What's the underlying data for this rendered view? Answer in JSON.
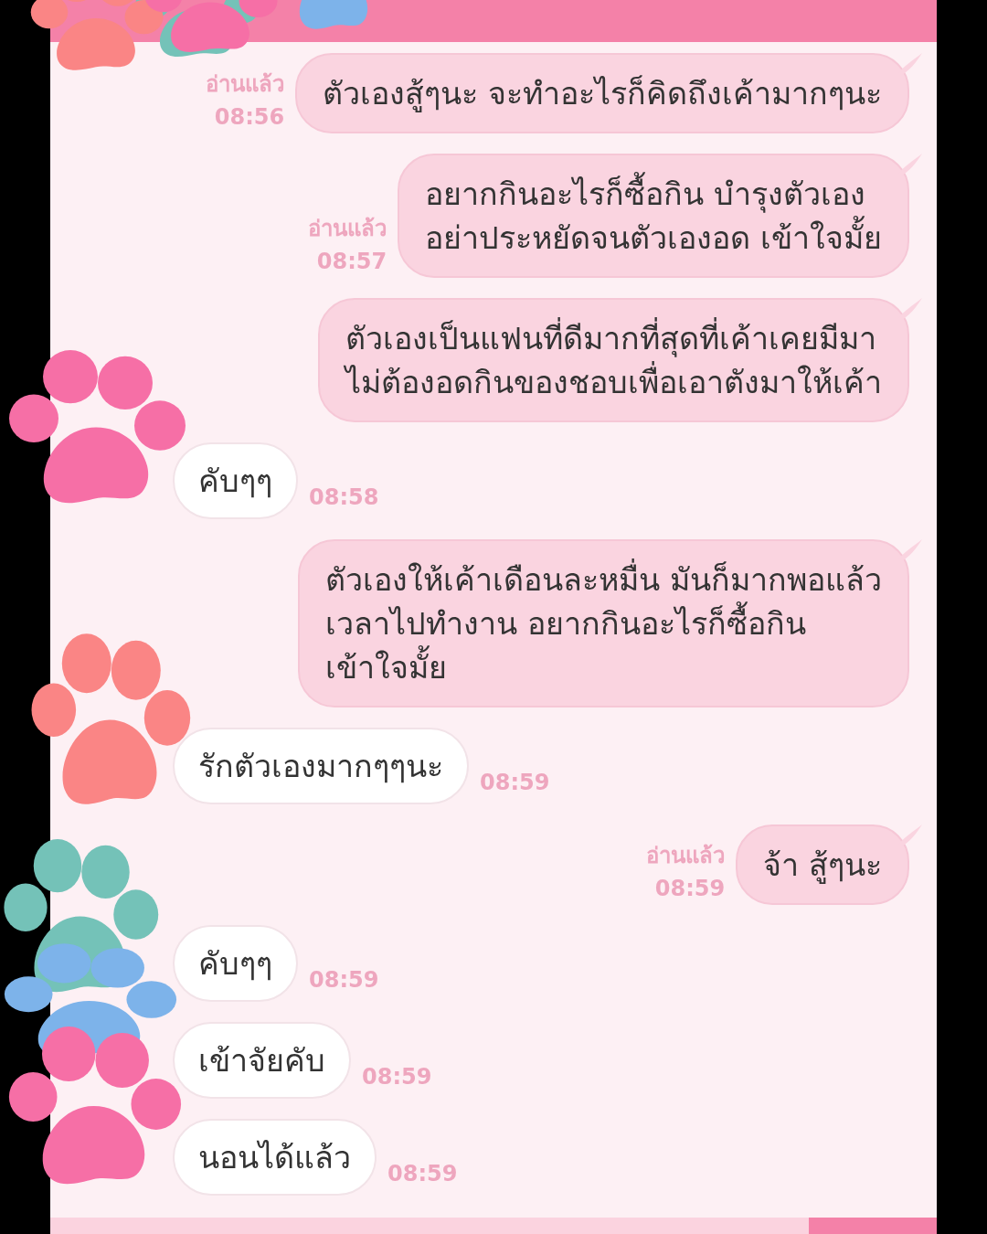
{
  "messages": [
    {
      "kind": "sent",
      "text": "ตัวเองสู้ๆนะ จะทำอะไรก็คิดถึงเค้ามากๆนะ",
      "read": "อ่านแล้ว",
      "time": "08:56"
    },
    {
      "kind": "sent",
      "text": "อยากกินอะไรก็ซื้อกิน บำรุงตัวเอง\nอย่าประหยัดจนตัวเองอด เข้าใจมั้ย",
      "read": "อ่านแล้ว",
      "time": "08:57"
    },
    {
      "kind": "sent",
      "text": "ตัวเองเป็นแฟนที่ดีมากที่สุดที่เค้าเคยมีมา\nไม่ต้องอดกินของชอบเพื่อเอาตังมาให้เค้า"
    },
    {
      "kind": "received",
      "text": "คับๆๆ",
      "time": "08:58"
    },
    {
      "kind": "sent",
      "text": "ตัวเองให้เค้าเดือนละหมื่น มันก็มากพอแล้ว\nเวลาไปทำงาน อยากกินอะไรก็ซื้อกิน\nเข้าใจมั้ย"
    },
    {
      "kind": "received",
      "text": "รักตัวเองมากๆๆนะ",
      "time": "08:59"
    },
    {
      "kind": "sent",
      "text": "จ้า สู้ๆนะ",
      "read": "อ่านแล้ว",
      "time": "08:59"
    },
    {
      "kind": "received",
      "text": "คับๆๆ",
      "time": "08:59"
    },
    {
      "kind": "received",
      "text": "เข้าจัยคับ",
      "time": "08:59"
    },
    {
      "kind": "received",
      "text": "นอนได้แล้ว",
      "time": "08:59"
    }
  ],
  "stickers": [
    {
      "color": "#74c2b8"
    },
    {
      "color": "#fa8585"
    },
    {
      "color": "#f66fa6"
    },
    {
      "color": "#7db3ea"
    },
    {
      "color": "#f66fa6"
    },
    {
      "color": "#fa8585"
    },
    {
      "color": "#74c2b8"
    },
    {
      "color": "#7db3ea"
    },
    {
      "color": "#f66fa6"
    }
  ]
}
